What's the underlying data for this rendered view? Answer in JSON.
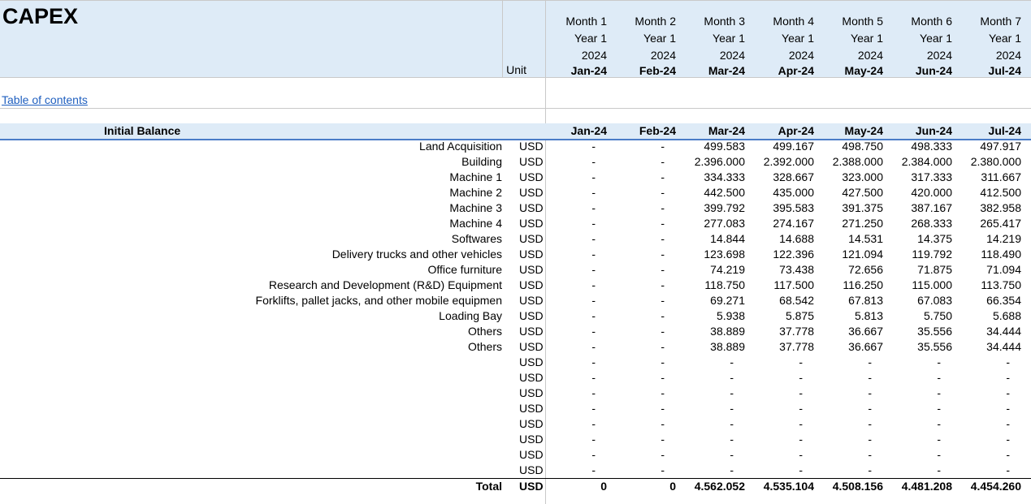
{
  "title": "CAPEX",
  "unit_header": "Unit",
  "toc_link": "Table of contents",
  "months": [
    {
      "month": "Month 1",
      "year": "Year 1",
      "yr": "2024",
      "label": "Jan-24"
    },
    {
      "month": "Month 2",
      "year": "Year 1",
      "yr": "2024",
      "label": "Feb-24"
    },
    {
      "month": "Month 3",
      "year": "Year 1",
      "yr": "2024",
      "label": "Mar-24"
    },
    {
      "month": "Month 4",
      "year": "Year 1",
      "yr": "2024",
      "label": "Apr-24"
    },
    {
      "month": "Month 5",
      "year": "Year 1",
      "yr": "2024",
      "label": "May-24"
    },
    {
      "month": "Month 6",
      "year": "Year 1",
      "yr": "2024",
      "label": "Jun-24"
    },
    {
      "month": "Month 7",
      "year": "Year 1",
      "yr": "2024",
      "label": "Jul-24"
    }
  ],
  "section_label": "Initial Balance",
  "rows": [
    {
      "label": "Land Acquisition",
      "unit": "USD",
      "values": [
        "-",
        "-",
        "499.583",
        "499.167",
        "498.750",
        "498.333",
        "497.917"
      ]
    },
    {
      "label": "Building",
      "unit": "USD",
      "values": [
        "-",
        "-",
        "2.396.000",
        "2.392.000",
        "2.388.000",
        "2.384.000",
        "2.380.000"
      ]
    },
    {
      "label": "Machine 1",
      "unit": "USD",
      "values": [
        "-",
        "-",
        "334.333",
        "328.667",
        "323.000",
        "317.333",
        "311.667"
      ]
    },
    {
      "label": "Machine 2",
      "unit": "USD",
      "values": [
        "-",
        "-",
        "442.500",
        "435.000",
        "427.500",
        "420.000",
        "412.500"
      ]
    },
    {
      "label": "Machine 3",
      "unit": "USD",
      "values": [
        "-",
        "-",
        "399.792",
        "395.583",
        "391.375",
        "387.167",
        "382.958"
      ]
    },
    {
      "label": "Machine 4",
      "unit": "USD",
      "values": [
        "-",
        "-",
        "277.083",
        "274.167",
        "271.250",
        "268.333",
        "265.417"
      ]
    },
    {
      "label": "Softwares",
      "unit": "USD",
      "values": [
        "-",
        "-",
        "14.844",
        "14.688",
        "14.531",
        "14.375",
        "14.219"
      ]
    },
    {
      "label": "Delivery trucks and other vehicles",
      "unit": "USD",
      "values": [
        "-",
        "-",
        "123.698",
        "122.396",
        "121.094",
        "119.792",
        "118.490"
      ]
    },
    {
      "label": "Office furniture",
      "unit": "USD",
      "values": [
        "-",
        "-",
        "74.219",
        "73.438",
        "72.656",
        "71.875",
        "71.094"
      ]
    },
    {
      "label": "Research and Development (R&D) Equipment",
      "unit": "USD",
      "values": [
        "-",
        "-",
        "118.750",
        "117.500",
        "116.250",
        "115.000",
        "113.750"
      ]
    },
    {
      "label": "Forklifts, pallet jacks, and other mobile equipmen",
      "unit": "USD",
      "values": [
        "-",
        "-",
        "69.271",
        "68.542",
        "67.813",
        "67.083",
        "66.354"
      ]
    },
    {
      "label": "Loading Bay",
      "unit": "USD",
      "values": [
        "-",
        "-",
        "5.938",
        "5.875",
        "5.813",
        "5.750",
        "5.688"
      ]
    },
    {
      "label": "Others",
      "unit": "USD",
      "values": [
        "-",
        "-",
        "38.889",
        "37.778",
        "36.667",
        "35.556",
        "34.444"
      ]
    },
    {
      "label": "Others",
      "unit": "USD",
      "values": [
        "-",
        "-",
        "38.889",
        "37.778",
        "36.667",
        "35.556",
        "34.444"
      ]
    },
    {
      "label": "",
      "unit": "USD",
      "values": [
        "-",
        "-",
        "-",
        "-",
        "-",
        "-",
        "-"
      ]
    },
    {
      "label": "",
      "unit": "USD",
      "values": [
        "-",
        "-",
        "-",
        "-",
        "-",
        "-",
        "-"
      ]
    },
    {
      "label": "",
      "unit": "USD",
      "values": [
        "-",
        "-",
        "-",
        "-",
        "-",
        "-",
        "-"
      ]
    },
    {
      "label": "",
      "unit": "USD",
      "values": [
        "-",
        "-",
        "-",
        "-",
        "-",
        "-",
        "-"
      ]
    },
    {
      "label": "",
      "unit": "USD",
      "values": [
        "-",
        "-",
        "-",
        "-",
        "-",
        "-",
        "-"
      ]
    },
    {
      "label": "",
      "unit": "USD",
      "values": [
        "-",
        "-",
        "-",
        "-",
        "-",
        "-",
        "-"
      ]
    },
    {
      "label": "",
      "unit": "USD",
      "values": [
        "-",
        "-",
        "-",
        "-",
        "-",
        "-",
        "-"
      ]
    },
    {
      "label": "",
      "unit": "USD",
      "values": [
        "-",
        "-",
        "-",
        "-",
        "-",
        "-",
        "-"
      ]
    }
  ],
  "total": {
    "label": "Total",
    "unit": "USD",
    "values": [
      "0",
      "0",
      "4.562.052",
      "4.535.104",
      "4.508.156",
      "4.481.208",
      "4.454.260"
    ]
  }
}
